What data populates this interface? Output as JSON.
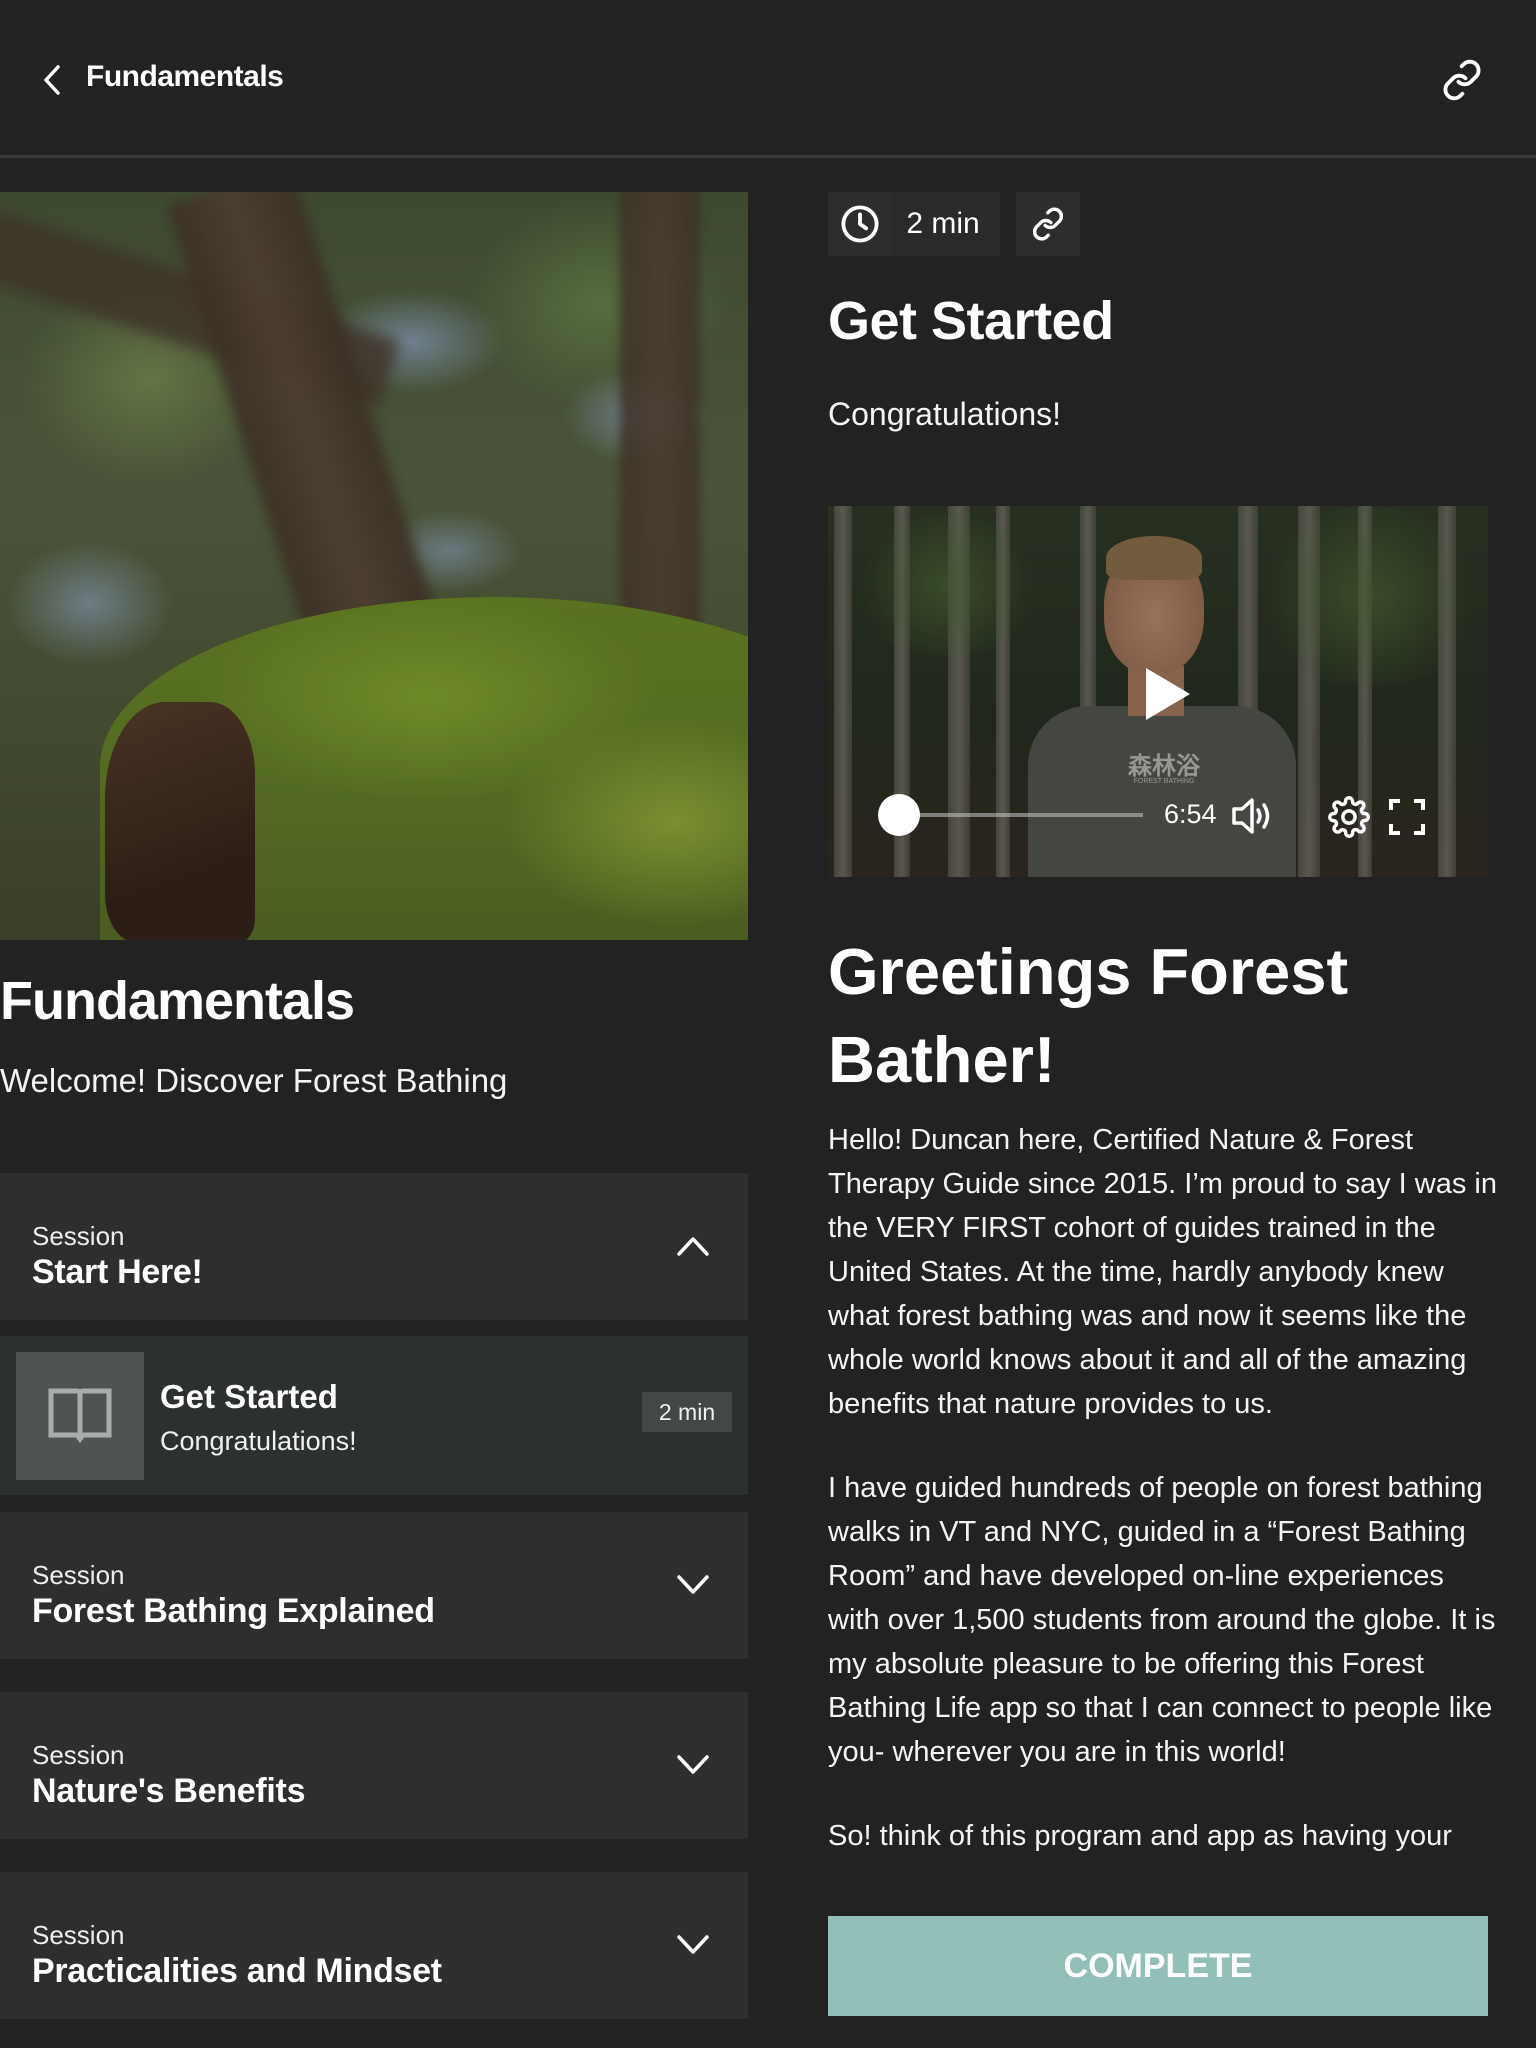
{
  "header": {
    "back_icon": "chevron-left-icon",
    "title": "Fundamentals",
    "link_icon": "link-icon"
  },
  "course": {
    "hero_image": "moss-covered-log-in-forest",
    "title": "Fundamentals",
    "subtitle": "Welcome!  Discover Forest Bathing"
  },
  "sessions": [
    {
      "label": "Session",
      "name": "Start Here!",
      "expanded": true,
      "chevron_icon": "chevron-up-icon",
      "lessons": [
        {
          "icon": "book-icon",
          "title": "Get Started",
          "subtitle": "Congratulations!",
          "duration": "2 min"
        }
      ]
    },
    {
      "label": "Session",
      "name": "Forest Bathing Explained",
      "expanded": false,
      "chevron_icon": "chevron-down-icon"
    },
    {
      "label": "Session",
      "name": "Nature's Benefits",
      "expanded": false,
      "chevron_icon": "chevron-down-icon"
    },
    {
      "label": "Session",
      "name": "Practicalities and Mindset",
      "expanded": false,
      "chevron_icon": "chevron-down-icon"
    }
  ],
  "lesson": {
    "clock_icon": "clock-icon",
    "duration": "2 min",
    "link_icon": "link-icon",
    "title": "Get Started",
    "subtitle": "Congratulations!"
  },
  "video": {
    "thumbnail": "man-in-forest-speaking",
    "shirt_text": "森林浴",
    "shirt_subtext": "FOREST BATHING",
    "play_icon": "play-icon",
    "progress": 0.0,
    "time_remaining": "6:54",
    "volume_icon": "volume-icon",
    "settings_icon": "gear-icon",
    "fullscreen_icon": "fullscreen-icon"
  },
  "article": {
    "heading": "Greetings Forest Bather!",
    "paragraphs": [
      "Hello! Duncan here, Certified Nature & Forest Therapy Guide since 2015. I’m proud to say I was in the VERY FIRST cohort of guides trained in the United States. At the time, hardly anybody knew what forest bathing was and now it seems like the whole world knows about it and all of the amazing benefits that nature provides to us.",
      "I have guided hundreds of people on forest bathing walks in VT and NYC, guided in a “Forest Bathing Room” and have developed on-line experiences with over 1,500 students from around the globe. It is my absolute pleasure to be offering this Forest Bathing Life app so that I can connect to people like you- wherever you are in this world!",
      "So! think of this program and app as having your"
    ]
  },
  "footer": {
    "complete_label": "COMPLETE",
    "complete_color": "#92c0b8"
  },
  "colors": {
    "background": "#222222",
    "session_card": "#2e2e2e",
    "lesson_card": "#2d3030",
    "accent": "#92c0b8"
  }
}
